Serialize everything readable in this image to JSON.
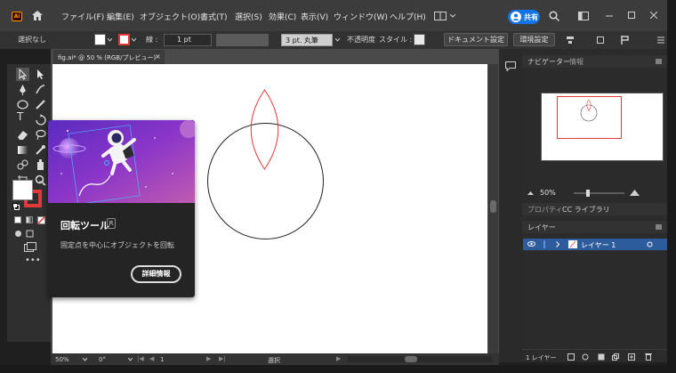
{
  "menubar": {
    "logo": "Ai",
    "items": [
      "ファイル(F)",
      "編集(E)",
      "オブジェクト(O)",
      "書式(T)",
      "選択(S)",
      "効果(C)",
      "表示(V)",
      "ウィンドウ(W)",
      "ヘルプ(H)"
    ],
    "share_label": "共有"
  },
  "controlbar": {
    "selection_label": "選択なし",
    "stroke_label": "線 :",
    "stroke_weight": "1 pt",
    "brush_label": "3 pt. 丸筆",
    "opacity_label": "不透明度",
    "style_label": "スタイル :",
    "doc_settings_label": "ドキュメント設定",
    "prefs_label": "環境設定"
  },
  "document": {
    "tab_title": "fig.ai* @ 50 % (RGB/プレビュー)",
    "tab_close": "×"
  },
  "statusbar": {
    "zoom": "50%",
    "rotation": "0°",
    "artboard_num": "1",
    "status_text": "選択"
  },
  "tooltip": {
    "title": "回転ツール",
    "shortcut": "R",
    "description": "固定点を中心にオブジェクトを回転",
    "more_button": "詳細情報"
  },
  "navigator": {
    "tab_navigator": "ナビゲーター",
    "tab_info": "情報",
    "zoom": "50%"
  },
  "properties": {
    "tab_properties": "プロパティ",
    "tab_libraries": "CC ライブラリ"
  },
  "layers": {
    "tab_label": "レイヤー",
    "layer_name": "レイヤー 1",
    "footer_count": "1 レイヤー"
  },
  "colors": {
    "accent_blue": "#1473e6",
    "path_red": "#e0393c",
    "layer_selected": "#2c5c9c",
    "nav_frame": "#e23c3c"
  }
}
